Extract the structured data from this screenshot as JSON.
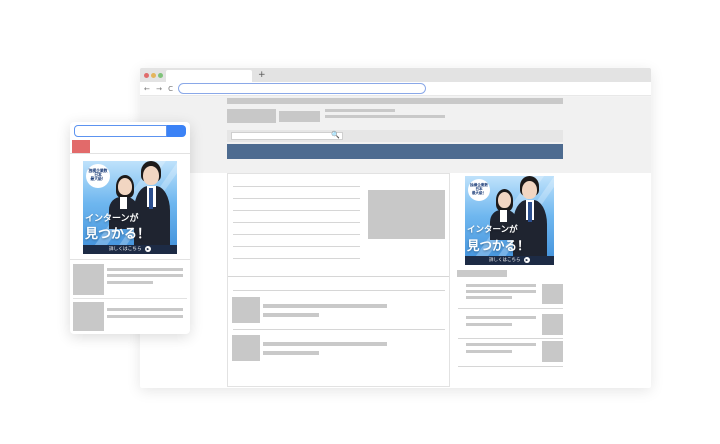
{
  "browser": {
    "new_tab_symbol": "+",
    "nav_icons": "← → C",
    "search_icon_glyph": "🔍",
    "colors": {
      "nav_bar": "#4d6b90",
      "window_dot_red": "#e06c6c",
      "window_dot_yellow": "#e4b55c",
      "window_dot_green": "#7fc27a",
      "mobile_search_button": "#3b82f6",
      "mobile_menu_badge": "#e26a6a"
    }
  },
  "ad": {
    "badge_lines": [
      "独横企業数",
      "日本",
      "最大級！"
    ],
    "headline_line1": "インターンが",
    "headline_line2": "見つかる！",
    "cta_label": "詳しくはこちら",
    "cta_arrow": "▶"
  }
}
